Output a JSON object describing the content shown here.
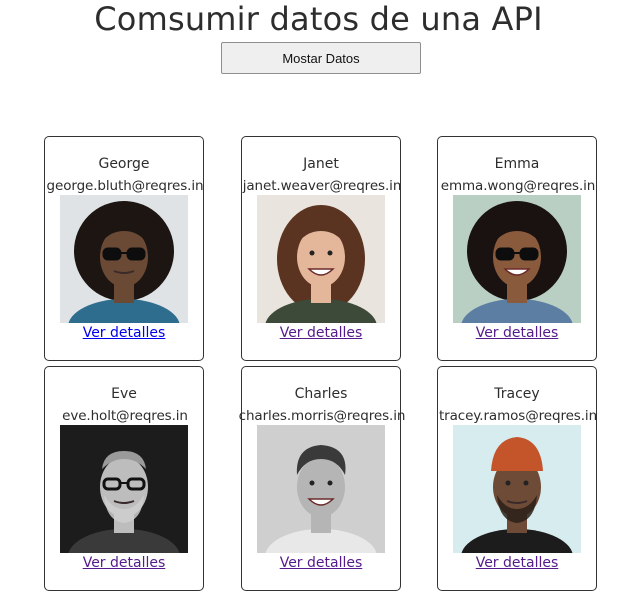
{
  "header": {
    "title": "Comsumir datos de una API",
    "button_label": "Mostar Datos"
  },
  "users": [
    {
      "name": "George",
      "email": "george.bluth@reqres.in",
      "link": "Ver detalles",
      "bg": "#dfe3e6",
      "skin": "#6b4a35",
      "hair": "#1c1512",
      "shirt": "#2f6d8f"
    },
    {
      "name": "Janet",
      "email": "janet.weaver@reqres.in",
      "link": "Ver detalles",
      "bg": "#e9e4dd",
      "skin": "#e4b69a",
      "hair": "#5a3420",
      "shirt": "#3d4a3a"
    },
    {
      "name": "Emma",
      "email": "emma.wong@reqres.in",
      "link": "Ver detalles",
      "bg": "#b9cfc4",
      "skin": "#8a5a3c",
      "hair": "#1a1210",
      "shirt": "#5d7ea3"
    },
    {
      "name": "Eve",
      "email": "eve.holt@reqres.in",
      "link": "Ver detalles",
      "bg": "#1c1c1c",
      "skin": "#bdbdbd",
      "hair": "#9a9a9a",
      "shirt": "#3a3a3a"
    },
    {
      "name": "Charles",
      "email": "charles.morris@reqres.in",
      "link": "Ver detalles",
      "bg": "#cfcfcf",
      "skin": "#b5b5b5",
      "hair": "#3a3a3a",
      "shirt": "#e8e8e8"
    },
    {
      "name": "Tracey",
      "email": "tracey.ramos@reqres.in",
      "link": "Ver detalles",
      "bg": "#d7ecef",
      "skin": "#6e4b36",
      "hair": "#c4542a",
      "shirt": "#1c1c1c"
    }
  ]
}
